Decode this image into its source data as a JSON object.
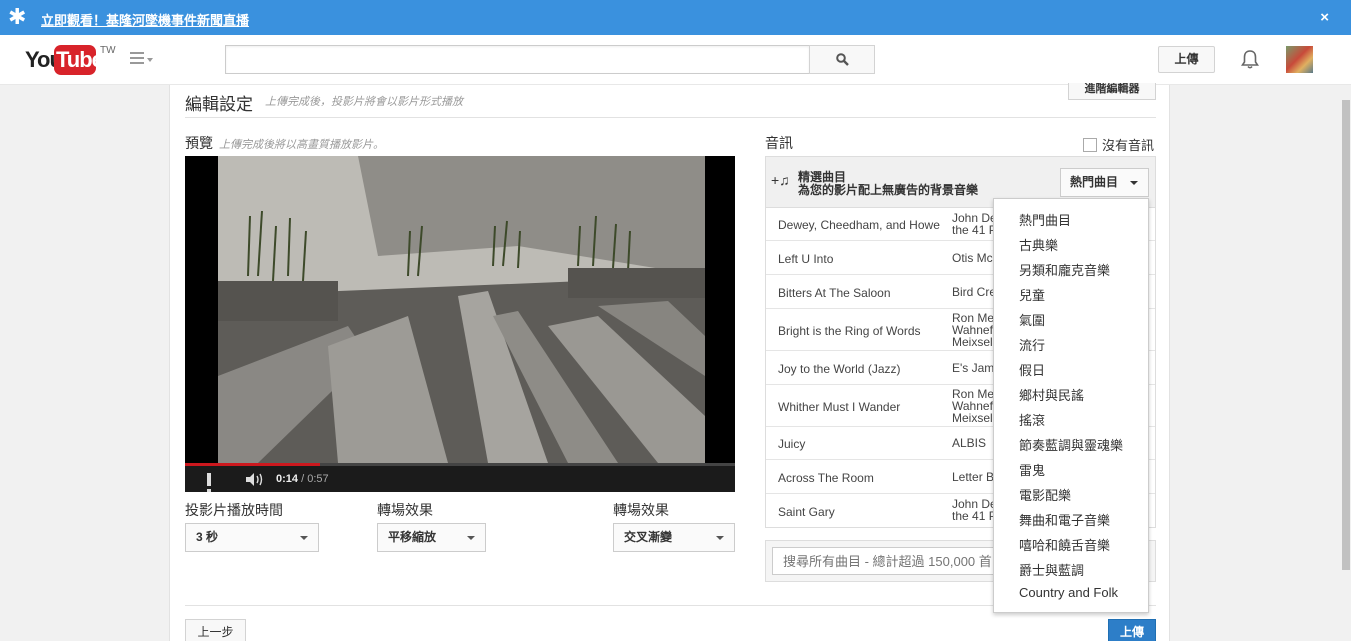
{
  "alert": {
    "link_text": "立即觀看！基隆河墜機事件新聞直播",
    "close": "×"
  },
  "masthead": {
    "logo_you": "You",
    "logo_tube": "Tube",
    "logo_region": "TW",
    "search_value": "",
    "upload_label": "上傳"
  },
  "editor": {
    "title": "編輯設定",
    "title_sub": "上傳完成後，投影片將會以影片形式播放",
    "advanced_label": "進階編輯器",
    "preview_label": "預覽",
    "preview_sub": "上傳完成後將以高畫質播放影片。",
    "player": {
      "current_time": "0:14",
      "duration": "/ 0:57",
      "progress": 0.245
    },
    "fields": [
      {
        "label": "投影片播放時間",
        "value": "3 秒"
      },
      {
        "label": "轉場效果",
        "value": "平移縮放"
      },
      {
        "label": "轉場效果",
        "value": "交叉漸變"
      }
    ],
    "back_label": "上一步",
    "upload_label": "上傳"
  },
  "audio": {
    "label": "音訊",
    "no_audio_label": "沒有音訊",
    "featured_title": "精選曲目",
    "featured_sub": "為您的影片配上無廣告的背景音樂",
    "genre_button": "熱門曲目",
    "tracks": [
      {
        "name": "Dewey, Cheedham, and Howe",
        "artist": "John De the 41 P"
      },
      {
        "name": "Left U Into",
        "artist": "Otis Mc"
      },
      {
        "name": "Bitters At The Saloon",
        "artist": "Bird Cre"
      },
      {
        "name": "Bright is the Ring of Words",
        "artist": "Ron Me Wahnef Meixsel"
      },
      {
        "name": "Joy to the World (Jazz)",
        "artist": "E's Jam"
      },
      {
        "name": "Whither Must I Wander",
        "artist": "Ron Me Wahnef Meixsel"
      },
      {
        "name": "Juicy",
        "artist": "ALBIS"
      },
      {
        "name": "Across The Room",
        "artist": "Letter B"
      },
      {
        "name": "Saint Gary",
        "artist": "John De the 41 P"
      }
    ],
    "search_placeholder": "搜尋所有曲目 - 總計超過 150,000 首"
  },
  "genre_menu": [
    "熱門曲目",
    "古典樂",
    "另類和龐克音樂",
    "兒童",
    "氣圍",
    "流行",
    "假日",
    "鄉村與民謠",
    "搖滾",
    "節奏藍調與靈魂樂",
    "雷鬼",
    "電影配樂",
    "舞曲和電子音樂",
    "嘻哈和饒舌音樂",
    "爵士與藍調",
    "Country and Folk"
  ],
  "colors": {
    "accent": "#3a91de",
    "upload_blue": "#2d7ec8",
    "progress_red": "#cc181e"
  }
}
